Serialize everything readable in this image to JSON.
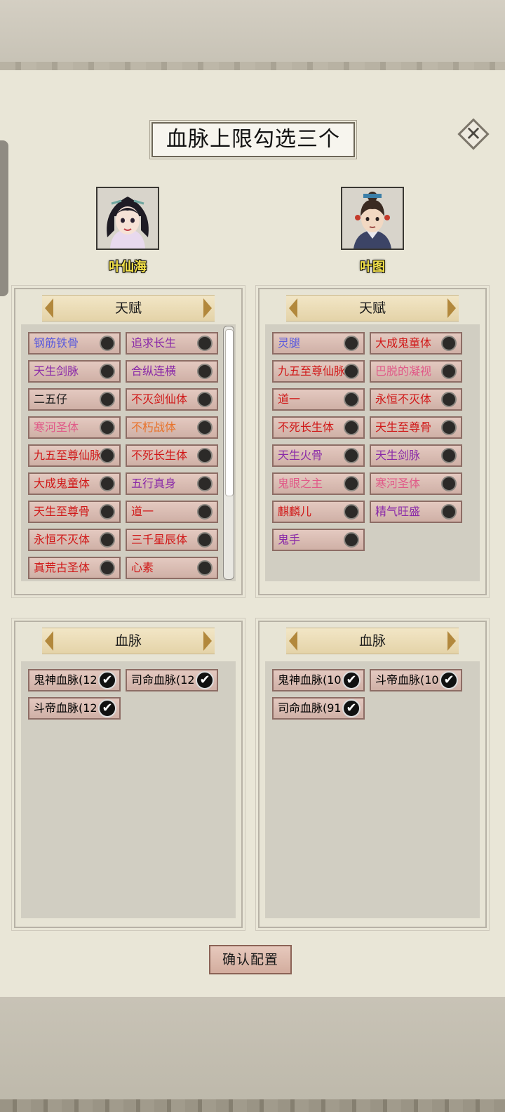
{
  "title": "血脉上限勾选三个",
  "close_icon": "close-icon",
  "confirm_label": "确认配置",
  "heroes": [
    {
      "name": "叶仙海"
    },
    {
      "name": "叶图"
    }
  ],
  "talent_header": "天赋",
  "bloodline_header": "血脉",
  "left_talents": [
    {
      "label": "钢筋铁骨",
      "color": "#5a5adc"
    },
    {
      "label": "追求长生",
      "color": "#8a2aa8"
    },
    {
      "label": "天生剑脉",
      "color": "#8a2aa8"
    },
    {
      "label": "合纵连横",
      "color": "#8a2aa8"
    },
    {
      "label": "二五仔",
      "color": "#1a1a1a"
    },
    {
      "label": "不灭剑仙体",
      "color": "#d01818"
    },
    {
      "label": "寒河圣体",
      "color": "#e05a88"
    },
    {
      "label": "不朽战体",
      "color": "#e8722a"
    },
    {
      "label": "九五至尊仙脉",
      "color": "#d01818"
    },
    {
      "label": "不死长生体",
      "color": "#d01818"
    },
    {
      "label": "大成鬼童体",
      "color": "#d01818"
    },
    {
      "label": "五行真身",
      "color": "#8a2aa8"
    },
    {
      "label": "天生至尊骨",
      "color": "#d01818"
    },
    {
      "label": "道一",
      "color": "#d01818"
    },
    {
      "label": "永恒不灭体",
      "color": "#d01818"
    },
    {
      "label": "三千星辰体",
      "color": "#d01818"
    },
    {
      "label": "真荒古圣体",
      "color": "#d01818"
    },
    {
      "label": "心素",
      "color": "#d01818"
    }
  ],
  "right_talents": [
    {
      "label": "灵腿",
      "color": "#5a5adc"
    },
    {
      "label": "大成鬼童体",
      "color": "#d01818"
    },
    {
      "label": "九五至尊仙脉",
      "color": "#d01818"
    },
    {
      "label": "巴脱的凝视",
      "color": "#e05a88"
    },
    {
      "label": "道一",
      "color": "#d01818"
    },
    {
      "label": "永恒不灭体",
      "color": "#d01818"
    },
    {
      "label": "不死长生体",
      "color": "#d01818"
    },
    {
      "label": "天生至尊骨",
      "color": "#d01818"
    },
    {
      "label": "天生火骨",
      "color": "#8a2aa8"
    },
    {
      "label": "天生剑脉",
      "color": "#8a2aa8"
    },
    {
      "label": "鬼眼之主",
      "color": "#e05a88"
    },
    {
      "label": "寒河圣体",
      "color": "#e05a88"
    },
    {
      "label": "麒麟儿",
      "color": "#d01818"
    },
    {
      "label": "精气旺盛",
      "color": "#8a2aa8"
    },
    {
      "label": "鬼手",
      "color": "#8a2aa8"
    }
  ],
  "left_bloodlines": [
    {
      "label": "鬼神血脉(12"
    },
    {
      "label": "司命血脉(12"
    },
    {
      "label": "斗帝血脉(12"
    }
  ],
  "right_bloodlines": [
    {
      "label": "鬼神血脉(10"
    },
    {
      "label": "斗帝血脉(10"
    },
    {
      "label": "司命血脉(91"
    }
  ]
}
